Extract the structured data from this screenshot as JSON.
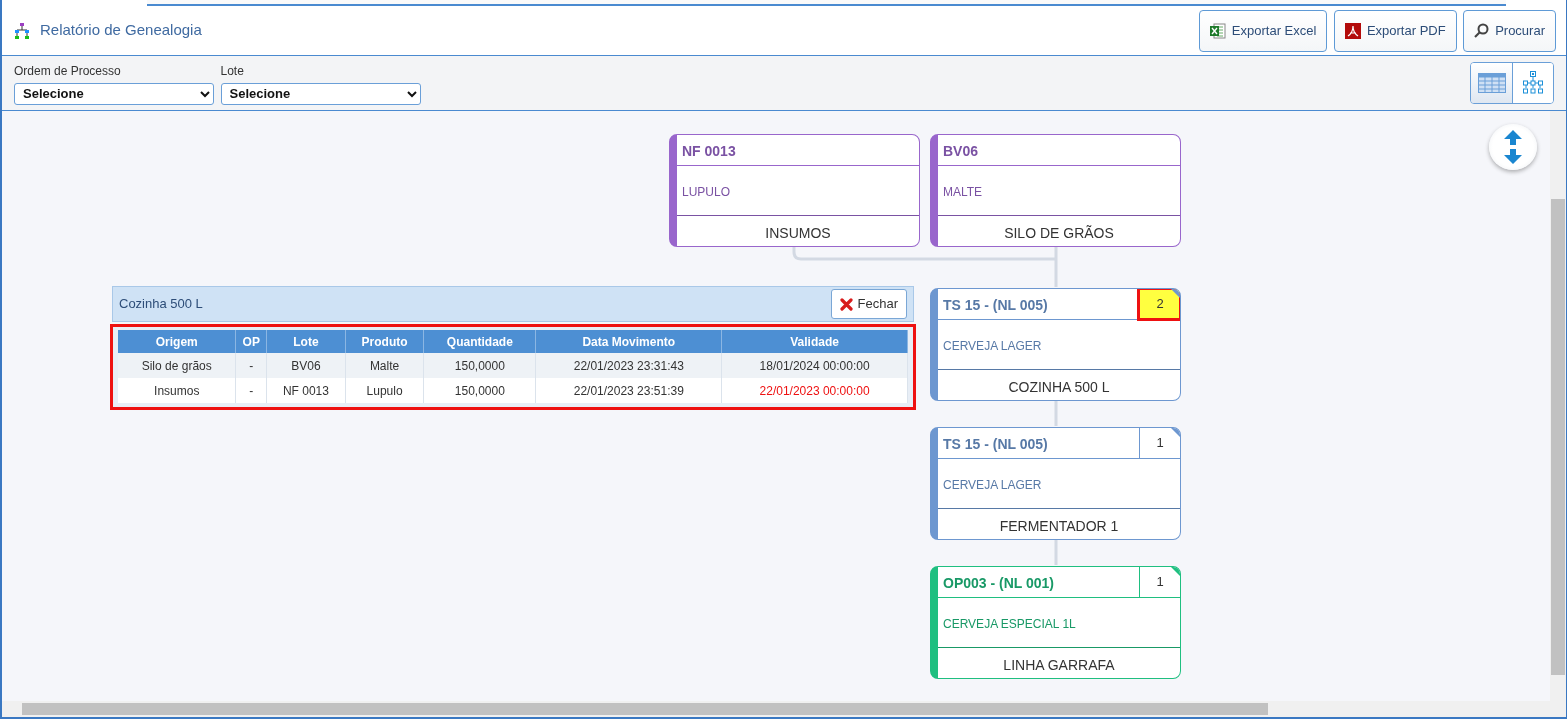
{
  "header": {
    "title": "Relatório de Genealogia",
    "buttons": [
      {
        "label": "Exportar Excel",
        "kind": "excel"
      },
      {
        "label": "Exportar PDF",
        "kind": "pdf"
      },
      {
        "label": "Procurar",
        "kind": "search"
      }
    ]
  },
  "filters": [
    {
      "label": "Ordem de Processo",
      "value": "Selecione"
    },
    {
      "label": "Lote",
      "value": "Selecione"
    }
  ],
  "view_toggle": [
    {
      "kind": "table",
      "selected": true
    },
    {
      "kind": "tree",
      "selected": false
    }
  ],
  "nodes": [
    {
      "title": "NF 0013",
      "product": "LUPULO",
      "location": "INSUMOS",
      "color": "#9966cc"
    },
    {
      "title": "BV06",
      "product": "MALTE",
      "location": "SILO DE GRÃOS",
      "color": "#9966cc"
    },
    {
      "title": "TS 15 - (NL 005)",
      "product": "CERVEJA LAGER",
      "location": "COZINHA 500 L",
      "color": "#6d97d0",
      "count": {
        "text": "2",
        "selected": true,
        "highlighted": true
      }
    },
    {
      "title": "TS 15 - (NL 005)",
      "product": "CERVEJA LAGER",
      "location": "FERMENTADOR 1",
      "color": "#6d97d0",
      "count": {
        "text": "1",
        "selected": false,
        "highlighted": false
      }
    },
    {
      "title": "OP003 - (NL 001)",
      "product": "CERVEJA ESPECIAL 1L",
      "location": "LINHA GARRAFA",
      "color": "#1fbf80",
      "count": {
        "text": "1",
        "selected": false,
        "highlighted": false
      }
    }
  ],
  "detail_panel": {
    "title": "Cozinha 500 L",
    "close_button": "Fechar",
    "highlighted": true,
    "columns": [
      "Origem",
      "OP",
      "Lote",
      "Produto",
      "Quantidade",
      "Data Movimento",
      "Validade"
    ],
    "rows": [
      {
        "cells": [
          "Silo de grãos",
          "-",
          "BV06",
          "Malte",
          "150,0000",
          "22/01/2023 23:31:43",
          "18/01/2024 00:00:00"
        ],
        "expired": false
      },
      {
        "cells": [
          "Insumos",
          "-",
          "NF 0013",
          "Lupulo",
          "150,0000",
          "22/01/2023 23:51:39",
          "22/01/2023 00:00:00"
        ],
        "expired": true
      }
    ]
  }
}
